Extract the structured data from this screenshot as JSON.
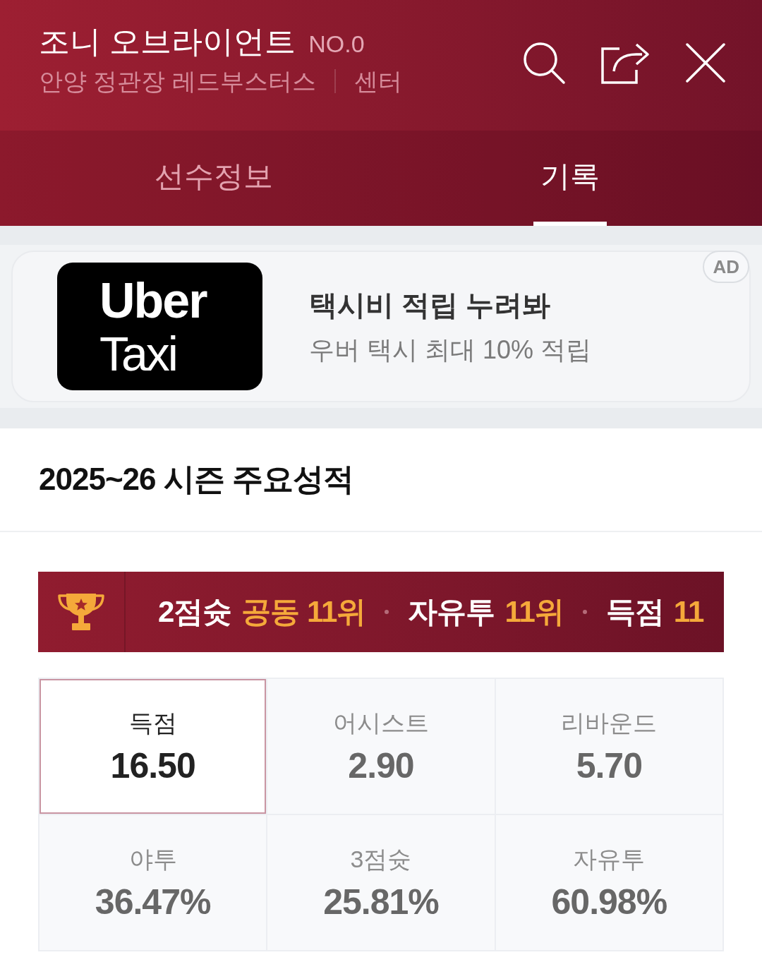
{
  "header": {
    "player_name": "조니 오브라이언트",
    "number": "NO.0",
    "team": "안양 정관장 레드부스터스",
    "position": "센터"
  },
  "tabs": [
    {
      "label": "선수정보",
      "selected": false
    },
    {
      "label": "기록",
      "selected": true
    }
  ],
  "ad": {
    "logo_lines": [
      "Uber",
      "Taxi"
    ],
    "title": "택시비 적립 누려봐",
    "subtitle": "우버 택시 최대 10% 적립",
    "badge": "AD"
  },
  "season_stats": {
    "title": "2025~26 시즌 주요성적",
    "rankings": [
      {
        "category": "2점슛",
        "rank": "공동 11위"
      },
      {
        "category": "자유투",
        "rank": "11위"
      },
      {
        "category": "득점",
        "rank": "11"
      }
    ],
    "stats": [
      {
        "label": "득점",
        "value": "16.50",
        "selected": true
      },
      {
        "label": "어시스트",
        "value": "2.90",
        "selected": false
      },
      {
        "label": "리바운드",
        "value": "5.70",
        "selected": false
      },
      {
        "label": "야투",
        "value": "36.47%",
        "selected": false
      },
      {
        "label": "3점슛",
        "value": "25.81%",
        "selected": false
      },
      {
        "label": "자유투",
        "value": "60.98%",
        "selected": false
      }
    ]
  }
}
